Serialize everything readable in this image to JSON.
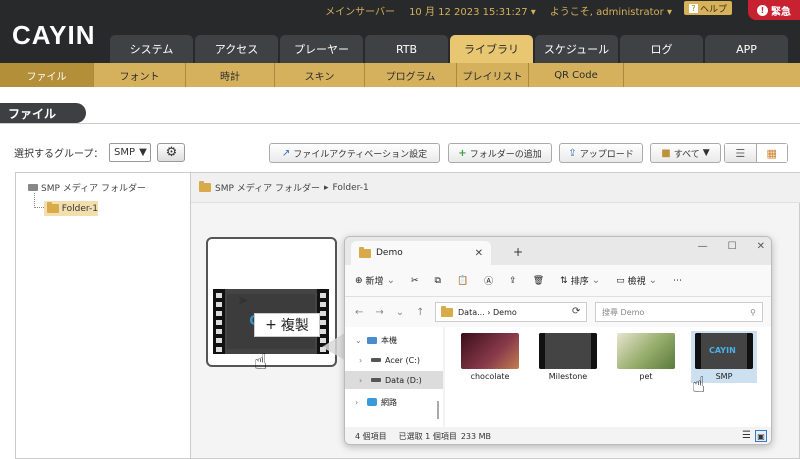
{
  "header": {
    "logo": "CAYIN",
    "server": "メインサーバー",
    "datetime": "10 月 12 2023 15:31:27",
    "welcome": "ようこそ, administrator",
    "help_label": "ヘルプ",
    "urgent_label": "緊急"
  },
  "nav_tabs": [
    {
      "label": "システム"
    },
    {
      "label": "アクセス"
    },
    {
      "label": "プレーヤー"
    },
    {
      "label": "RTB"
    },
    {
      "label": "ライブラリ",
      "active": true
    },
    {
      "label": "スケジュール"
    },
    {
      "label": "ログ"
    },
    {
      "label": "APP"
    }
  ],
  "sub_tabs": [
    {
      "label": "ファイル",
      "active": true
    },
    {
      "label": "フォント"
    },
    {
      "label": "時計"
    },
    {
      "label": "スキン"
    },
    {
      "label": "プログラム"
    },
    {
      "label": "プレイリスト"
    },
    {
      "label": "QR Code"
    }
  ],
  "page_title": "ファイル",
  "group": {
    "label": "選択するグループ：",
    "value": "SMP"
  },
  "toolbar": {
    "activation": "ファイルアクティベーション設定",
    "add_folder": "フォルダーの追加",
    "upload": "アップロード",
    "filter": "すべて"
  },
  "tree": {
    "root": "SMP メディア フォルダー",
    "child": "Folder-1"
  },
  "breadcrumb": {
    "root": "SMP メディア フォルダー",
    "child": "Folder-1"
  },
  "drag": {
    "copy_label": "複製",
    "thumb_text": "CAYIN"
  },
  "explorer": {
    "tab_title": "Demo",
    "commands": {
      "new": "新增",
      "sort": "排序",
      "view": "檢視"
    },
    "address": "Data... › Demo",
    "search_placeholder": "搜尋 Demo",
    "sidebar": [
      {
        "label": "本機",
        "icon": "pc-icon"
      },
      {
        "label": "Acer (C:)",
        "icon": "drive-icon"
      },
      {
        "label": "Data (D:)",
        "icon": "drive-icon",
        "selected": true
      },
      {
        "label": "網路",
        "icon": "network-icon"
      }
    ],
    "files": [
      {
        "name": "chocolate",
        "color": "#6a2a3a"
      },
      {
        "name": "Milestone",
        "color": "#444444"
      },
      {
        "name": "pet",
        "color": "#8aa060"
      },
      {
        "name": "SMP",
        "color": "#2a2a2a",
        "selected": true
      }
    ],
    "status": {
      "count": "4 個項目",
      "selected": "已選取 1 個項目",
      "size": "233 MB"
    }
  },
  "colors": {
    "accent": "#d5b15d",
    "header_bg": "#27292b",
    "urgent": "#c82130",
    "active_tab": "#e9c772"
  }
}
